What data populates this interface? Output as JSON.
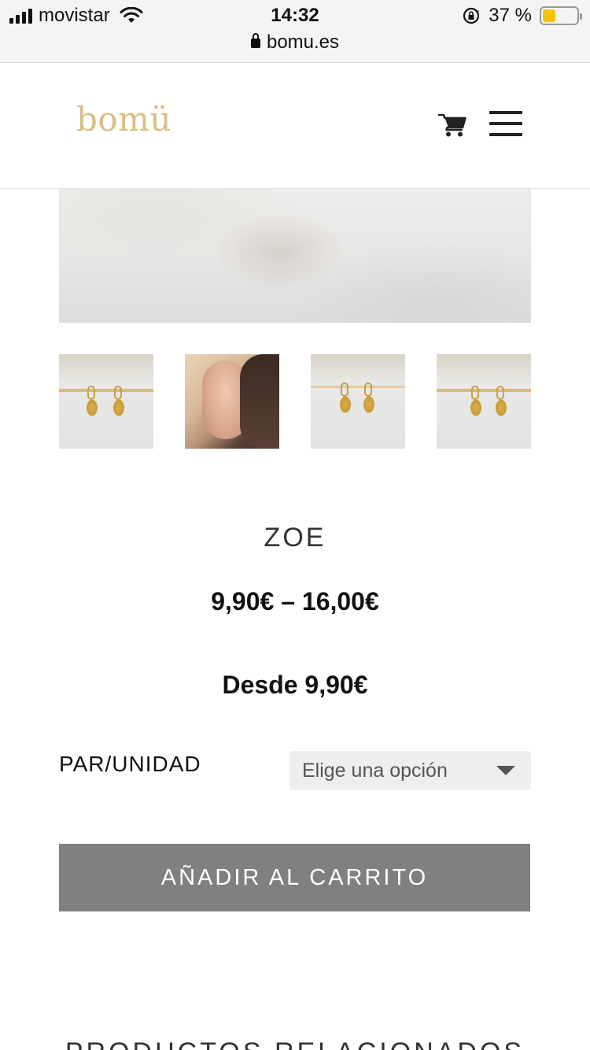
{
  "status_bar": {
    "carrier": "movistar",
    "time": "14:32",
    "battery_percent": "37 %",
    "battery_level": 0.37,
    "url": "bomu.es"
  },
  "header": {
    "logo": "bomü",
    "icons": [
      "cart-icon",
      "menu-icon"
    ]
  },
  "product": {
    "title": "ZOE",
    "price_range": "9,90€ – 16,00€",
    "price_from": "Desde 9,90€",
    "variant_label": "PAR/UNIDAD",
    "variant_select_value": "Elige una opción",
    "add_to_cart_label": "AÑADIR AL CARRITO"
  },
  "gallery": {
    "thumbnails": [
      "earrings-on-stick",
      "model-wearing-earring",
      "earrings-on-fabric",
      "earrings-on-stick-closeup"
    ]
  },
  "related": {
    "title": "PRODUCTOS RELACIONADOS"
  },
  "colors": {
    "logo_gold": "#d9bf85",
    "button_gray": "#808080",
    "battery_yellow": "#f5c400"
  }
}
